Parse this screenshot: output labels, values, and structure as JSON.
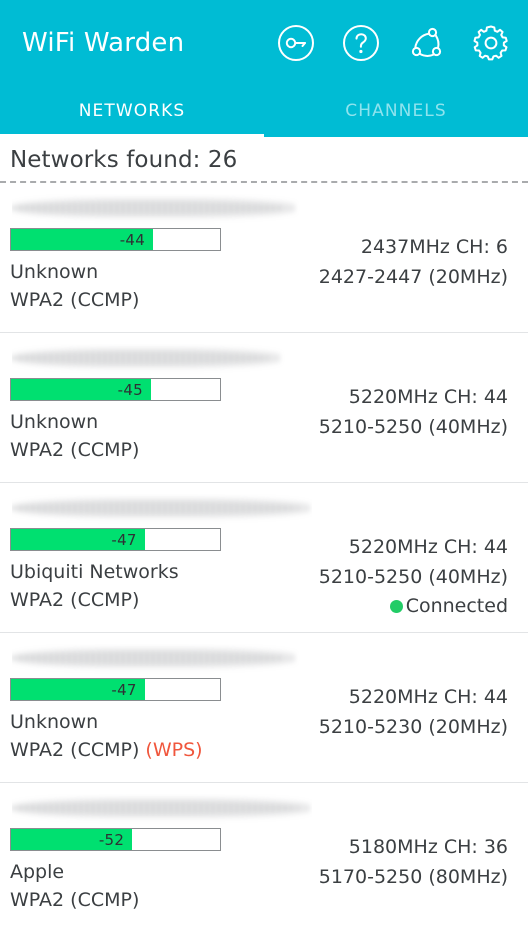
{
  "header": {
    "title": "WiFi Warden",
    "accent_color": "#00bcd4",
    "actions": [
      {
        "name": "key-icon",
        "label": "Key"
      },
      {
        "name": "help-icon",
        "label": "Help"
      },
      {
        "name": "share-icon",
        "label": "Share"
      },
      {
        "name": "settings-icon",
        "label": "Settings"
      }
    ]
  },
  "tabs": [
    {
      "label": "NETWORKS",
      "active": true
    },
    {
      "label": "CHANNELS",
      "active": false
    }
  ],
  "status": {
    "found_label": "Networks found: 26",
    "count": 26
  },
  "colors": {
    "teal": "#00bcd4",
    "signal_green": "#00e070",
    "connected_green": "#22cc66",
    "wps_red": "#f0563c",
    "text": "#3b3f42"
  },
  "networks": [
    {
      "ssid": "",
      "ssid_blurred": true,
      "signal": "-44",
      "signal_percent": 68,
      "vendor": "Unknown",
      "security": "WPA2 (CCMP)",
      "wps": "",
      "frequency": "2437MHz  CH: 6",
      "range": "2427-2447 (20MHz)",
      "connected_label": "",
      "connected": false
    },
    {
      "ssid": "",
      "ssid_blurred": true,
      "signal": "-45",
      "signal_percent": 67,
      "vendor": "Unknown",
      "security": "WPA2 (CCMP)",
      "wps": "",
      "frequency": "5220MHz  CH: 44",
      "range": "5210-5250 (40MHz)",
      "connected_label": "",
      "connected": false
    },
    {
      "ssid": "",
      "ssid_blurred": true,
      "signal": "-47",
      "signal_percent": 64,
      "vendor": "Ubiquiti Networks",
      "security": "WPA2 (CCMP)",
      "wps": "",
      "frequency": "5220MHz  CH: 44",
      "range": "5210-5250 (40MHz)",
      "connected_label": "Connected",
      "connected": true
    },
    {
      "ssid": "",
      "ssid_blurred": true,
      "signal": "-47",
      "signal_percent": 64,
      "vendor": "Unknown",
      "security": "WPA2 (CCMP)",
      "wps": "(WPS)",
      "frequency": "5220MHz  CH: 44",
      "range": "5210-5230 (20MHz)",
      "connected_label": "",
      "connected": false
    },
    {
      "ssid": "",
      "ssid_blurred": true,
      "signal": "-52",
      "signal_percent": 58,
      "vendor": "Apple",
      "security": "WPA2 (CCMP)",
      "wps": "",
      "frequency": "5180MHz  CH: 36",
      "range": "5170-5250 (80MHz)",
      "connected_label": "",
      "connected": false
    }
  ]
}
